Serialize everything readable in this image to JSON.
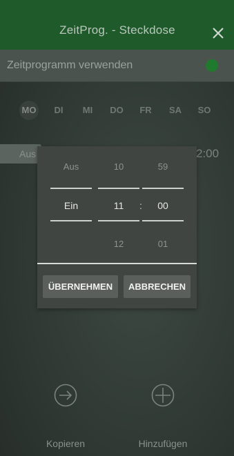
{
  "header": {
    "title": "ZeitProg. - Steckdose",
    "close_icon": "close-icon"
  },
  "toggle": {
    "label": "Zeitprogramm verwenden",
    "enabled": true,
    "accent": "#1f7a2d"
  },
  "days": {
    "items": [
      "MO",
      "DI",
      "MI",
      "DO",
      "FR",
      "SA",
      "SO"
    ],
    "selected": "MO"
  },
  "background_row": {
    "state": "Aus",
    "time": "2:00"
  },
  "picker": {
    "mode": {
      "prev": "Aus",
      "current": "Ein",
      "next": ""
    },
    "hour": {
      "prev": "10",
      "current": "11",
      "next": "12"
    },
    "separator": ":",
    "minute": {
      "prev": "59",
      "current": "00",
      "next": "01"
    },
    "buttons": {
      "apply": "ÜBERNEHMEN",
      "cancel": "ABBRECHEN"
    }
  },
  "actions": {
    "copy": {
      "label": "Kopieren",
      "icon": "arrow-right-circle-icon"
    },
    "add": {
      "label": "Hinzufügen",
      "icon": "plus-circle-icon"
    }
  }
}
